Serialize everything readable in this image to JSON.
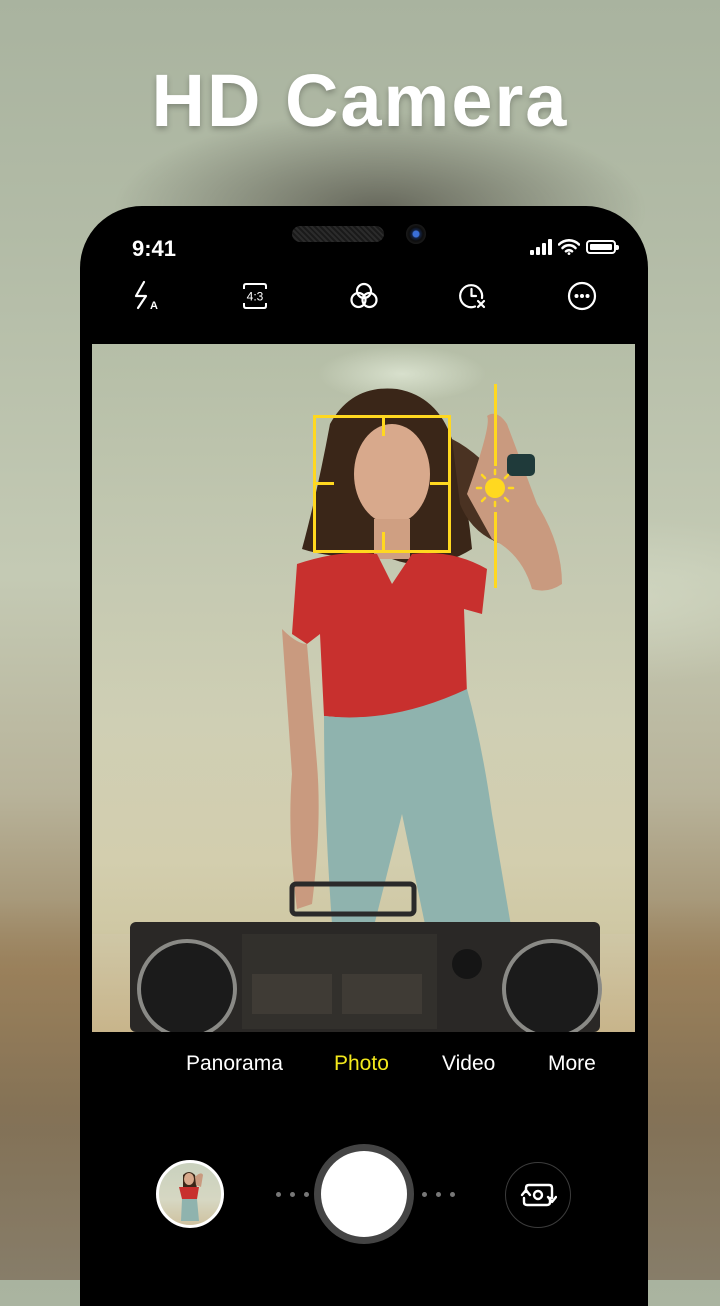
{
  "hero": {
    "title": "HD Camera"
  },
  "status_bar": {
    "time": "9:41",
    "icons": [
      "cellular-signal-icon",
      "wifi-icon",
      "battery-icon"
    ],
    "battery_level": 1.0
  },
  "toolbar": {
    "items": [
      {
        "name": "flash-auto",
        "icon": "flash-auto-icon",
        "badge": "A"
      },
      {
        "name": "aspect-ratio",
        "icon": "aspect-ratio-icon",
        "label": "4:3"
      },
      {
        "name": "filters",
        "icon": "filters-icon"
      },
      {
        "name": "timer-off",
        "icon": "timer-off-icon"
      },
      {
        "name": "more-options",
        "icon": "more-options-icon"
      }
    ]
  },
  "viewfinder": {
    "overlays": [
      "face-focus-box",
      "exposure-slider",
      "sun-icon"
    ],
    "accent_color": "#FFD820"
  },
  "modes": {
    "items": [
      "Panorama",
      "Photo",
      "Video",
      "More"
    ],
    "selected": "Photo",
    "active_color": "#F3E81C"
  },
  "controls": {
    "gallery_thumbnail": "last-photo-thumbnail",
    "shutter": "shutter-button",
    "switch_camera": "switch-camera-icon"
  }
}
